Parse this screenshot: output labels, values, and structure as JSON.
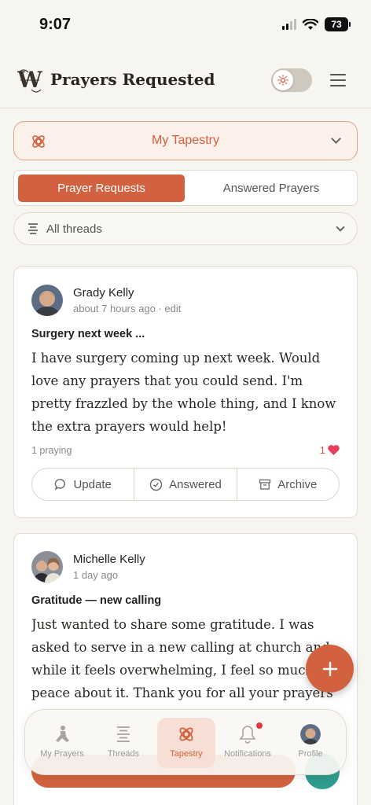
{
  "status_bar": {
    "time": "9:07",
    "battery": "73"
  },
  "header": {
    "title": "Prayers Requested",
    "logo_letters": "W"
  },
  "tapestry_selector": {
    "label": "My Tapestry"
  },
  "tabs": [
    {
      "label": "Prayer Requests",
      "active": true
    },
    {
      "label": "Answered Prayers",
      "active": false
    }
  ],
  "thread_filter": {
    "label": "All threads"
  },
  "posts": [
    {
      "author": "Grady Kelly",
      "meta": "about 7 hours ago · edit",
      "title": "Surgery next week ...",
      "body": "I have surgery coming up next week. Would love any prayers that you could send. I'm pretty frazzled by the whole thing, and I know the extra prayers would help!",
      "praying": "1 praying",
      "likes": "1",
      "actions": [
        "Update",
        "Answered",
        "Archive"
      ]
    },
    {
      "author": "Michelle Kelly",
      "meta": "1 day ago",
      "title": "Gratitude — new calling",
      "body": "Just wanted to share some gratitude. I was asked to serve in a new calling at church and while it feels overwhelming, I feel so much peace about it. Thank you for all your prayers"
    }
  ],
  "bottom_nav": [
    {
      "label": "My Prayers",
      "icon": "kneeling-person-icon"
    },
    {
      "label": "Threads",
      "icon": "threads-icon"
    },
    {
      "label": "Tapestry",
      "icon": "tapestry-knot-icon",
      "active": true
    },
    {
      "label": "Notifications",
      "icon": "bell-icon",
      "badge": true
    },
    {
      "label": "Profile",
      "icon": "avatar"
    }
  ],
  "colors": {
    "accent": "#D2623F",
    "background": "#F7F5F0",
    "teal": "#2E9C8E",
    "heart": "#E8405A"
  }
}
